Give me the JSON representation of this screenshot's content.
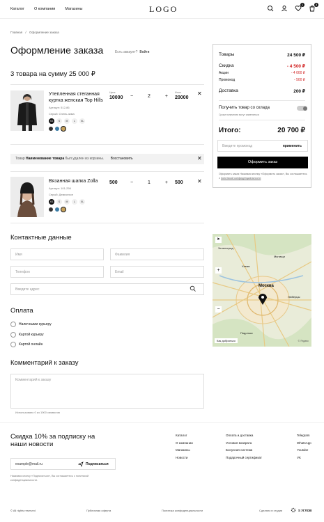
{
  "header": {
    "nav": [
      "Каталог",
      "О компании",
      "Магазины"
    ],
    "logo": "LOGO",
    "badge1": "1",
    "badge2": "3"
  },
  "breadcrumb": {
    "home": "Главная",
    "current": "Оформление заказа"
  },
  "title": "Оформление заказа",
  "account": {
    "q": "Есть аккаунт?",
    "login": "Войти"
  },
  "cart_summary": "3 товара на сумму 25 000 ₽",
  "items": [
    {
      "name": "Утепленная стеганная куртка женская Top Hills",
      "article": "Артикул: 512-86",
      "color": "Серый: Очень-зима",
      "price_label": "Цена",
      "price": "10000",
      "total_label": "Итого",
      "total": "20000",
      "qty": "2",
      "sizes": [
        "XS",
        "S",
        "M",
        "L",
        "XL"
      ]
    },
    {
      "name": "Вязанная шапка Zolla",
      "article": "Артикул: 101-256",
      "color": "Серый: Демисезон",
      "price": "500",
      "total": "500",
      "qty": "1",
      "sizes": [
        "XS",
        "S",
        "M",
        "L",
        "XL"
      ]
    }
  ],
  "notice": {
    "text_a": "Товар ",
    "bold": "Наименование товара",
    "text_b": " был удален из корзины.",
    "restore": "Восстановить"
  },
  "contacts": {
    "title": "Контактные данные",
    "name": "Имя",
    "surname": "Фамилия",
    "phone": "Телефон",
    "email": "Email",
    "address": "Введите адрес"
  },
  "payment": {
    "title": "Оплата",
    "options": [
      "Наличными курьеру",
      "Картой курьеру",
      "Картой онлайн"
    ]
  },
  "comment": {
    "title": "Комментарий к заказу",
    "placeholder": "Комментарий к заказу",
    "hint": "Использовано 0 из 1000 символов"
  },
  "summary": {
    "goods": "Товары",
    "goods_v": "24 500 ₽",
    "discount": "Скидка",
    "discount_v": "- 4 500 ₽",
    "promo_label": "Акции",
    "promo_v": "- 4 000 ₽",
    "promocode": "Промокод",
    "promocode_v": "- 500 ₽",
    "delivery": "Доставка",
    "delivery_v": "200 ₽",
    "pickup": "Получить товар со склада",
    "pickup_note": "Сроки получения могут измениться",
    "total": "Итого:",
    "total_v": "20 700 ₽",
    "promo_ph": "Введите промокод",
    "apply": "применить",
    "checkout": "Оформить заказ",
    "legal": "Оформить заказ Нажимая кнопку «Оформить заказ», Вы соглашаетесь с ",
    "legal_link": "политикой конфиденциальности"
  },
  "map": {
    "labels": [
      "Зеленоград",
      "Мытищи",
      "Химки",
      "Москва",
      "Люберцы",
      "Подольск"
    ],
    "footer_link": "Как добраться",
    "yandex": "© Яндекс"
  },
  "footer": {
    "subscribe_title": "Скидка 10% за подписку на наши новости",
    "email_ph": "example@mail.ru",
    "subscribe": "Подписаться",
    "subscribe_note": "Нажимая кнопку «Подписаться», Вы соглашаетесь с политикой конфиденциальности.",
    "col1": [
      "Каталог",
      "О компании",
      "Магазины",
      "Новости"
    ],
    "col2": [
      "Оплата и доставка",
      "Условия возврата",
      "Бонусная система",
      "Подарочный сертификат"
    ],
    "col3": [
      "Telegram",
      "WhatsApp",
      "Youtube",
      "VK"
    ],
    "copyright": "© All rights reserved",
    "offer": "Публичная оферта",
    "privacy": "Политика конфиденциальности",
    "studio": "Сделано в студии",
    "studio_name": "S УГЛОВ"
  }
}
